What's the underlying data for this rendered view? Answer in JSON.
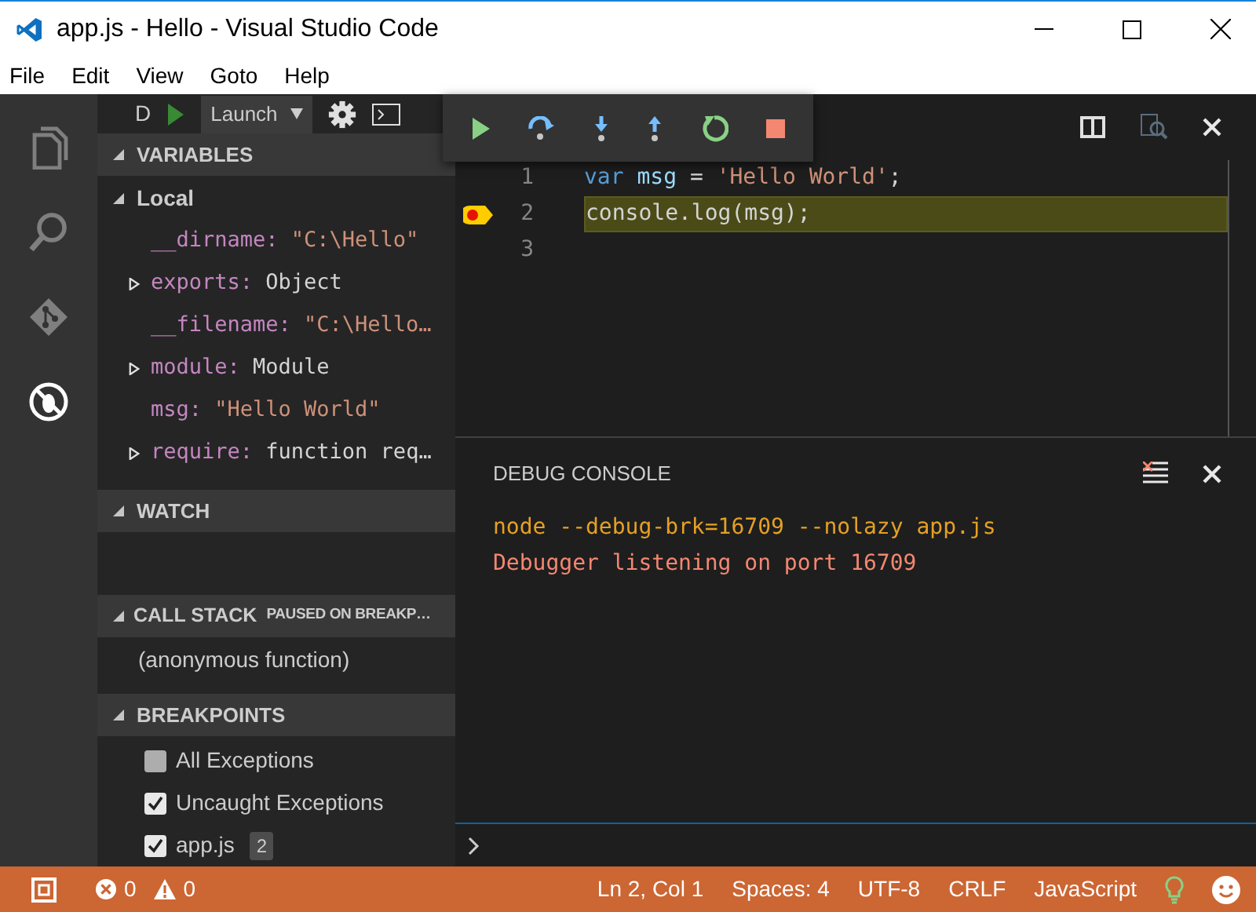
{
  "window": {
    "title": "app.js - Hello - Visual Studio Code"
  },
  "menu": [
    {
      "label": "File"
    },
    {
      "label": "Edit"
    },
    {
      "label": "View"
    },
    {
      "label": "Goto"
    },
    {
      "label": "Help"
    }
  ],
  "activity_bar": [
    {
      "kind": "files",
      "selected": false
    },
    {
      "kind": "search",
      "selected": false
    },
    {
      "kind": "git",
      "selected": false
    },
    {
      "kind": "debug",
      "selected": true
    }
  ],
  "debug_toolbar": {
    "label": "D",
    "configuration": "Launch"
  },
  "variables": {
    "title": "VARIABLES",
    "scope": "Local",
    "items": [
      {
        "name": "__dirname:",
        "value": "\"C:\\Hello\"",
        "kind": "string",
        "expandable": false
      },
      {
        "name": "exports:",
        "value": "Object",
        "kind": "object",
        "expandable": true
      },
      {
        "name": "__filename:",
        "value": "\"C:\\Hello…",
        "kind": "string",
        "expandable": false
      },
      {
        "name": "module:",
        "value": "Module",
        "kind": "object",
        "expandable": true
      },
      {
        "name": "msg:",
        "value": "\"Hello World\"",
        "kind": "string",
        "expandable": false
      },
      {
        "name": "require:",
        "value": "function req…",
        "kind": "object",
        "expandable": true
      }
    ]
  },
  "watch": {
    "title": "WATCH"
  },
  "call_stack": {
    "title": "CALL STACK",
    "status": "PAUSED ON BREAKP…",
    "frames": [
      {
        "label": "(anonymous function)"
      }
    ]
  },
  "breakpoints": {
    "title": "BREAKPOINTS",
    "items": [
      {
        "label": "All Exceptions",
        "checked": false
      },
      {
        "label": "Uncaught Exceptions",
        "checked": true
      },
      {
        "label": "app.js",
        "checked": true,
        "badge": "2"
      }
    ]
  },
  "editor": {
    "lines": [
      {
        "number": "1",
        "current": false,
        "breakpoint": false,
        "tokens": [
          {
            "text": "var",
            "kind": "keyword"
          },
          {
            "text": " msg",
            "kind": "variable"
          },
          {
            "text": " = ",
            "kind": "plain"
          },
          {
            "text": "'Hello World'",
            "kind": "string"
          },
          {
            "text": ";",
            "kind": "plain"
          }
        ]
      },
      {
        "number": "2",
        "current": true,
        "breakpoint": true,
        "tokens": [
          {
            "text": "console.log(msg);",
            "kind": "plain"
          }
        ]
      },
      {
        "number": "3",
        "current": false,
        "breakpoint": false
      }
    ]
  },
  "debug_console": {
    "title": "DEBUG CONSOLE",
    "lines": [
      {
        "text": "node --debug-brk=16709 --nolazy app.js",
        "kind": "command"
      },
      {
        "text": "Debugger listening on port 16709",
        "kind": "error"
      }
    ]
  },
  "status_bar": {
    "errors": "0",
    "warnings": "0",
    "items": [
      {
        "text": "Ln 2, Col 1"
      },
      {
        "text": "Spaces: 4"
      },
      {
        "text": "UTF-8"
      },
      {
        "text": "CRLF"
      },
      {
        "text": "JavaScript"
      }
    ]
  }
}
